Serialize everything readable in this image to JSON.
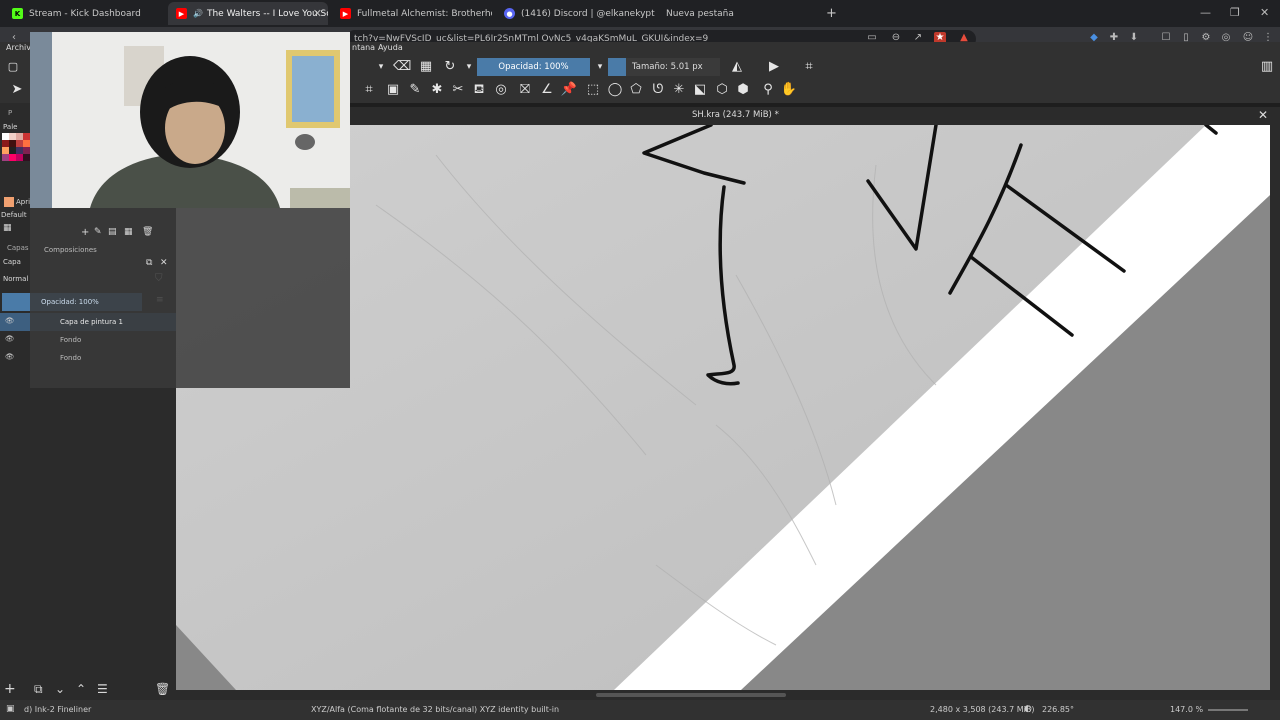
{
  "browser": {
    "tabs": [
      {
        "label": "Stream - Kick Dashboard",
        "icon": "kick-icon",
        "color": "#53fc18"
      },
      {
        "label": "The Walters -- I Love You So",
        "icon": "youtube-icon",
        "color": "#ff0000"
      },
      {
        "label": "Fullmetal Alchemist: Brotherhood All",
        "icon": "youtube-icon",
        "color": "#ff0000"
      },
      {
        "label": "(1416) Discord | @elkanekypt",
        "icon": "discord-icon",
        "color": "#5865f2"
      },
      {
        "label": "Nueva pestaña",
        "icon": "",
        "color": ""
      }
    ],
    "new_tab": "+",
    "url": "tch?v=NwFVScID_uc&list=PL6Ir2SnMTml OvNc5_v4gaKSmMuL_GKUI&index=9"
  },
  "menu": {
    "left_labels": [
      "Archivo"
    ],
    "right_labels": [
      "ntana",
      "Ayuda"
    ]
  },
  "toolbar": {
    "opacity_label": "Opacidad: 100%",
    "size_label": "Tamaño: 5.01 px"
  },
  "dock": {
    "palette_title": "Pale",
    "april_label": "Apri",
    "default_label": "Default",
    "capas_tab": "Capas",
    "composiciones_tab": "Composiciones",
    "capas_title": "Capa",
    "blend_mode": "Normal",
    "opacity": "Opacidad:  100%",
    "layers": [
      {
        "name": "Capa de pintura 1",
        "selected": true
      },
      {
        "name": "Fondo",
        "selected": false
      },
      {
        "name": "Fondo",
        "selected": false
      }
    ],
    "small_label": "P"
  },
  "canvas": {
    "title": "SH.kra (243.7 MiB) *"
  },
  "status": {
    "brush": "d) Ink-2 Fineliner",
    "colorspace": "XYZ/Alfa (Coma flotante de 32 bits/canal)  XYZ identity built-in",
    "dimensions": "2,480 x 3,508 (243.7 MiB)",
    "rotation": "226.85°",
    "zoom": "147.0 %"
  },
  "colors": {
    "accent": "#4a7ba8",
    "palette": [
      "#ffffff",
      "#f2d0c8",
      "#e0a8a0",
      "#cc3333",
      "#8a1a1a",
      "#401010",
      "#c04040",
      "#ff7040",
      "#ffa060",
      "#202020",
      "#403060",
      "#802050",
      "#a04080",
      "#ff0066",
      "#c00060",
      "#301020"
    ]
  }
}
